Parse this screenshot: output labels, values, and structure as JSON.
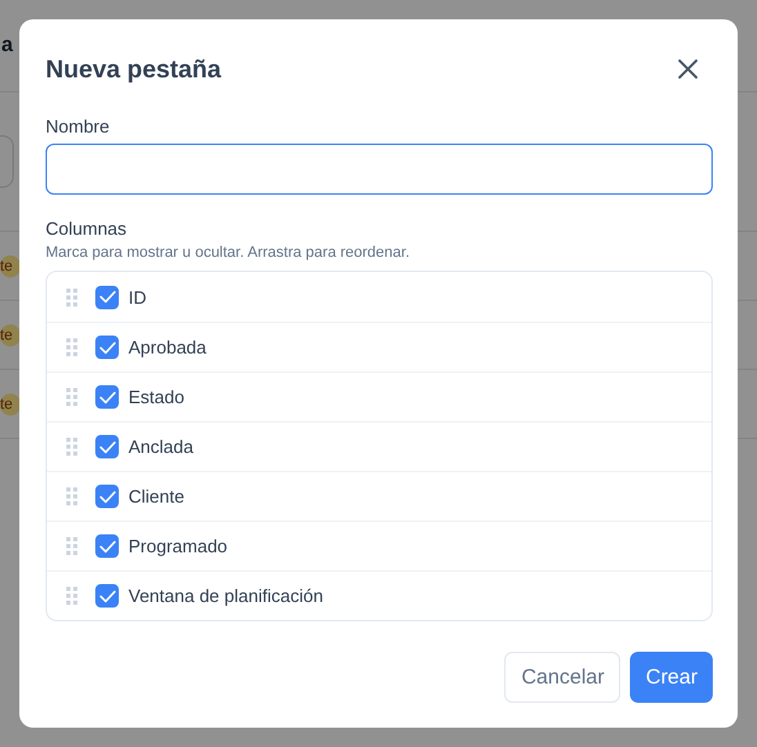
{
  "background": {
    "title": "a",
    "badges": [
      "te",
      "te",
      "te"
    ]
  },
  "dialog": {
    "title": "Nueva pestaña",
    "name_label": "Nombre",
    "columns_label": "Columnas",
    "columns_hint": "Marca para mostrar u ocultar. Arrastra para reordenar.",
    "columns": [
      {
        "label": "ID",
        "checked": true
      },
      {
        "label": "Aprobada",
        "checked": true
      },
      {
        "label": "Estado",
        "checked": true
      },
      {
        "label": "Anclada",
        "checked": true
      },
      {
        "label": "Cliente",
        "checked": true
      },
      {
        "label": "Programado",
        "checked": true
      },
      {
        "label": "Ventana de planificación",
        "checked": true
      }
    ],
    "buttons": [
      {
        "label": "Cancelar",
        "kind": "secondary"
      },
      {
        "label": "Crear",
        "kind": "primary"
      }
    ]
  }
}
